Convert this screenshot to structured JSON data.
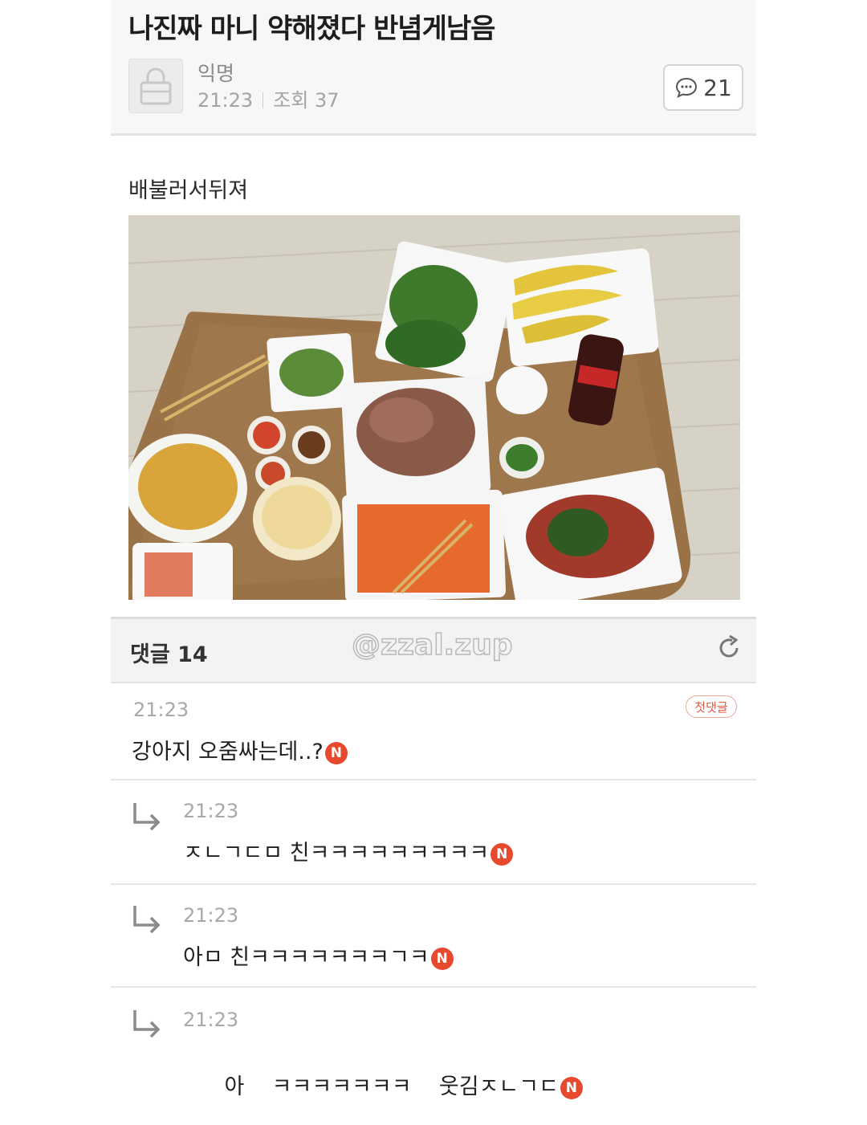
{
  "post": {
    "title": "나진짜 마니 약해졌다 반념게남음",
    "author": "익명",
    "time": "21:23",
    "views": "조회 37",
    "comment_button_count": "21",
    "body_text": "배불러서뒤져",
    "photo_icon": "food-table-photo"
  },
  "comments_bar": {
    "label": "댓글 14",
    "watermark": "@zzal.zup",
    "refresh_icon": "refresh-icon"
  },
  "comments": [
    {
      "time": "21:23",
      "text": "강아지 오줌싸는데..?",
      "badge": "첫댓글",
      "new": "N"
    },
    {
      "time": "21:23",
      "text": "ㅈㄴㄱㄷㅁ 친ㅋㅋㅋㅋㅋㅋㅋㅋㅋ",
      "new": "N"
    },
    {
      "time": "21:23",
      "text": "아ㅁ 친ㅋㅋㅋㅋㅋㅋㅋㄱㅋ",
      "new": "N"
    },
    {
      "time": "21:23",
      "text": "아    ㅋㅋㅋㅋㅋㅋㅋ    웃김ㅈㄴㄱㄷ",
      "new": "N"
    }
  ],
  "colors": {
    "new_badge": "#e8492e",
    "first_badge": "#e35a43",
    "header_bg": "#f7f7f7"
  }
}
